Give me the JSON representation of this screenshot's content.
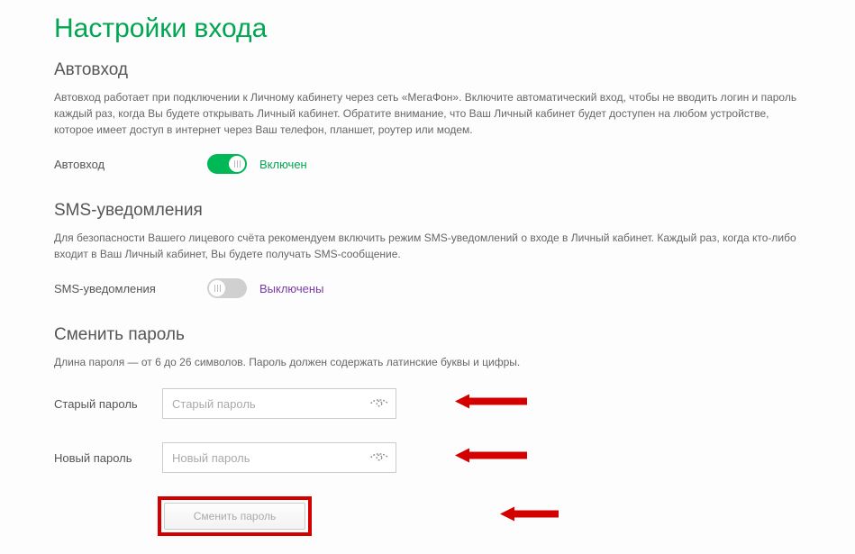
{
  "page_title": "Настройки входа",
  "autologin": {
    "title": "Автовход",
    "desc": "Автовход работает при подключении к Личному кабинету через сеть «МегаФон». Включите автоматический вход, чтобы не вводить логин и пароль каждый раз, когда Вы будете открывать Личный кабинет. Обратите внимание, что Ваш Личный кабинет будет доступен на любом устройстве, которое имеет доступ в интернет через Ваш телефон, планшет, роутер или модем.",
    "label": "Автовход",
    "state": "Включен"
  },
  "sms": {
    "title": "SMS-уведомления",
    "desc": "Для безопасности Вашего лицевого счёта рекомендуем включить режим SMS-уведомлений о входе в Личный кабинет. Каждый раз, когда кто-либо входит в Ваш Личный кабинет, Вы будете получать SMS-сообщение.",
    "label": "SMS-уведомления",
    "state": "Выключены"
  },
  "password": {
    "title": "Сменить пароль",
    "desc": "Длина пароля — от 6 до 26 символов. Пароль должен содержать латинские буквы и цифры.",
    "old_label": "Старый пароль",
    "old_placeholder": "Старый пароль",
    "new_label": "Новый пароль",
    "new_placeholder": "Новый пароль",
    "submit": "Сменить пароль"
  },
  "colors": {
    "accent": "#00a650",
    "highlight": "#d40000"
  }
}
